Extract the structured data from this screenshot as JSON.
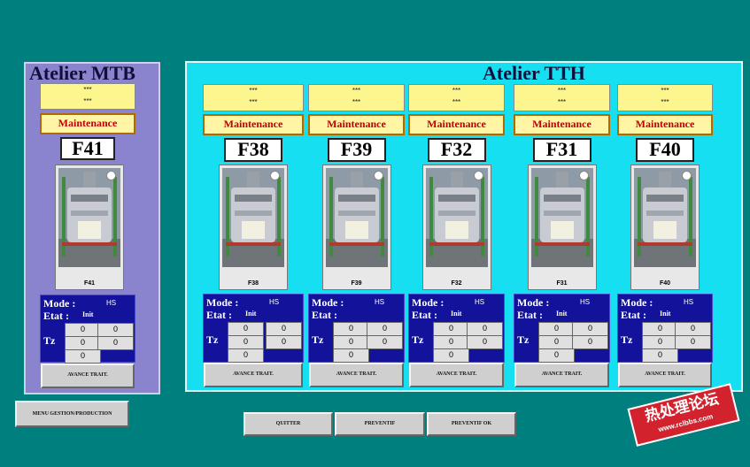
{
  "colors": {
    "background": "#007f7f",
    "mtb_panel": "#8a84ce",
    "tth_panel": "#16dff1",
    "status_panel": "#12129a",
    "maintenance_text": "#c00000",
    "info_box": "#fdf58e",
    "watermark": "#d1222e"
  },
  "icons": {
    "furnace_photo": "industrial-furnace-photo",
    "indicator": "status-indicator-dot"
  },
  "mtb": {
    "title": "Atelier MTB"
  },
  "tth": {
    "title": "Atelier TTH"
  },
  "furnaces": [
    {
      "id": "F41",
      "info_line1": "***",
      "info_line2": "***",
      "status": "Maintenance",
      "photo_label": "F41",
      "mode_label": "Mode :",
      "mode_value": "HS",
      "etat_label": "Etat :",
      "etat_value": "Init",
      "tz_label": "Tz",
      "tz": [
        "0",
        "0",
        "0",
        "0",
        "0"
      ],
      "avance_label": "AVANCE TRAIT."
    },
    {
      "id": "F38",
      "info_line1": "***",
      "info_line2": "***",
      "status": "Maintenance",
      "photo_label": "F38",
      "mode_label": "Mode :",
      "mode_value": "HS",
      "etat_label": "Etat :",
      "etat_value": "Init",
      "tz_label": "Tz",
      "tz": [
        "0",
        "0",
        "0",
        "0",
        "0"
      ],
      "avance_label": "AVANCE TRAIT."
    },
    {
      "id": "F39",
      "info_line1": "***",
      "info_line2": "***",
      "status": "Maintenance",
      "photo_label": "F39",
      "mode_label": "Mode :",
      "mode_value": "HS",
      "etat_label": "Etat :",
      "etat_value": "",
      "tz_label": "Tz",
      "tz": [
        "0",
        "0",
        "0",
        "0",
        "0"
      ],
      "avance_label": "AVANCE TRAIT."
    },
    {
      "id": "F32",
      "info_line1": "***",
      "info_line2": "***",
      "status": "Maintenance",
      "photo_label": "F32",
      "mode_label": "Mode :",
      "mode_value": "HS",
      "etat_label": "Etat :",
      "etat_value": "Init",
      "tz_label": "Tz",
      "tz": [
        "0",
        "0",
        "0",
        "0",
        "0"
      ],
      "avance_label": "AVANCE TRAIT."
    },
    {
      "id": "F31",
      "info_line1": "***",
      "info_line2": "***",
      "status": "Maintenance",
      "photo_label": "F31",
      "mode_label": "Mode :",
      "mode_value": "HS",
      "etat_label": "Etat :",
      "etat_value": "Init",
      "tz_label": "Tz",
      "tz": [
        "0",
        "0",
        "0",
        "0",
        "0"
      ],
      "avance_label": "AVANCE TRAIT."
    },
    {
      "id": "F40",
      "info_line1": "***",
      "info_line2": "***",
      "status": "Maintenance",
      "photo_label": "F40",
      "mode_label": "Mode :",
      "mode_value": "HS",
      "etat_label": "Etat :",
      "etat_value": "Init",
      "tz_label": "Tz",
      "tz": [
        "0",
        "0",
        "0",
        "0",
        "0"
      ],
      "avance_label": "AVANCE TRAIT."
    }
  ],
  "buttons": {
    "menu": "MENU GESTION/PRODUCTION",
    "quitter": "QUITTER",
    "preventif": "PREVENTIF",
    "preventif_ok": "PREVENTIF  OK"
  },
  "watermark": {
    "text": "热处理论坛",
    "url": "www.rclbbs.com"
  }
}
